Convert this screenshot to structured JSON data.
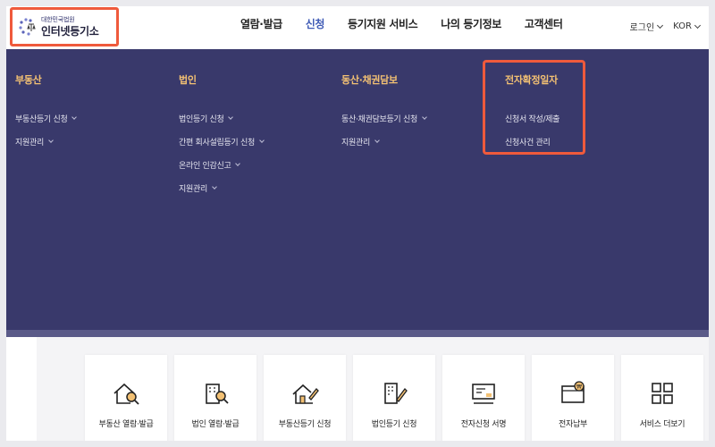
{
  "header": {
    "logo_sub": "대한민국법원",
    "logo_main": "인터넷등기소",
    "nav": [
      "열람·발급",
      "신청",
      "등기지원 서비스",
      "나의 등기정보",
      "고객센터"
    ],
    "active_nav": "신청",
    "login": "로그인",
    "language": "KOR"
  },
  "menu": {
    "columns": [
      {
        "title": "부동산",
        "items": [
          "부동산등기 신청",
          "지원관리"
        ]
      },
      {
        "title": "법인",
        "items": [
          "법인등기 신청",
          "간편 회사설립등기 신청",
          "온라인 인감신고",
          "지원관리"
        ]
      },
      {
        "title": "동산·채권담보",
        "items": [
          "동산·채권담보등기 신청",
          "지원관리"
        ]
      },
      {
        "title": "전자확정일자",
        "items": [
          "신청서 작성/제출",
          "신청사건 관리"
        ]
      }
    ]
  },
  "cards": [
    {
      "label": "부동산 열람·발급",
      "icon": "house-search-icon"
    },
    {
      "label": "법인 열람·발급",
      "icon": "building-search-icon"
    },
    {
      "label": "부동산등기 신청",
      "icon": "house-pen-icon"
    },
    {
      "label": "법인등기 신청",
      "icon": "building-pen-icon"
    },
    {
      "label": "전자신청 서명",
      "icon": "sign-icon"
    },
    {
      "label": "전자납부",
      "icon": "payment-icon"
    },
    {
      "label": "서비스 더보기",
      "icon": "grid-icon"
    }
  ],
  "colors": {
    "menu_bg": "#39396b",
    "menu_title": "#f2c073",
    "highlight": "#ef5a3c",
    "active_nav": "#3f5bb5"
  }
}
